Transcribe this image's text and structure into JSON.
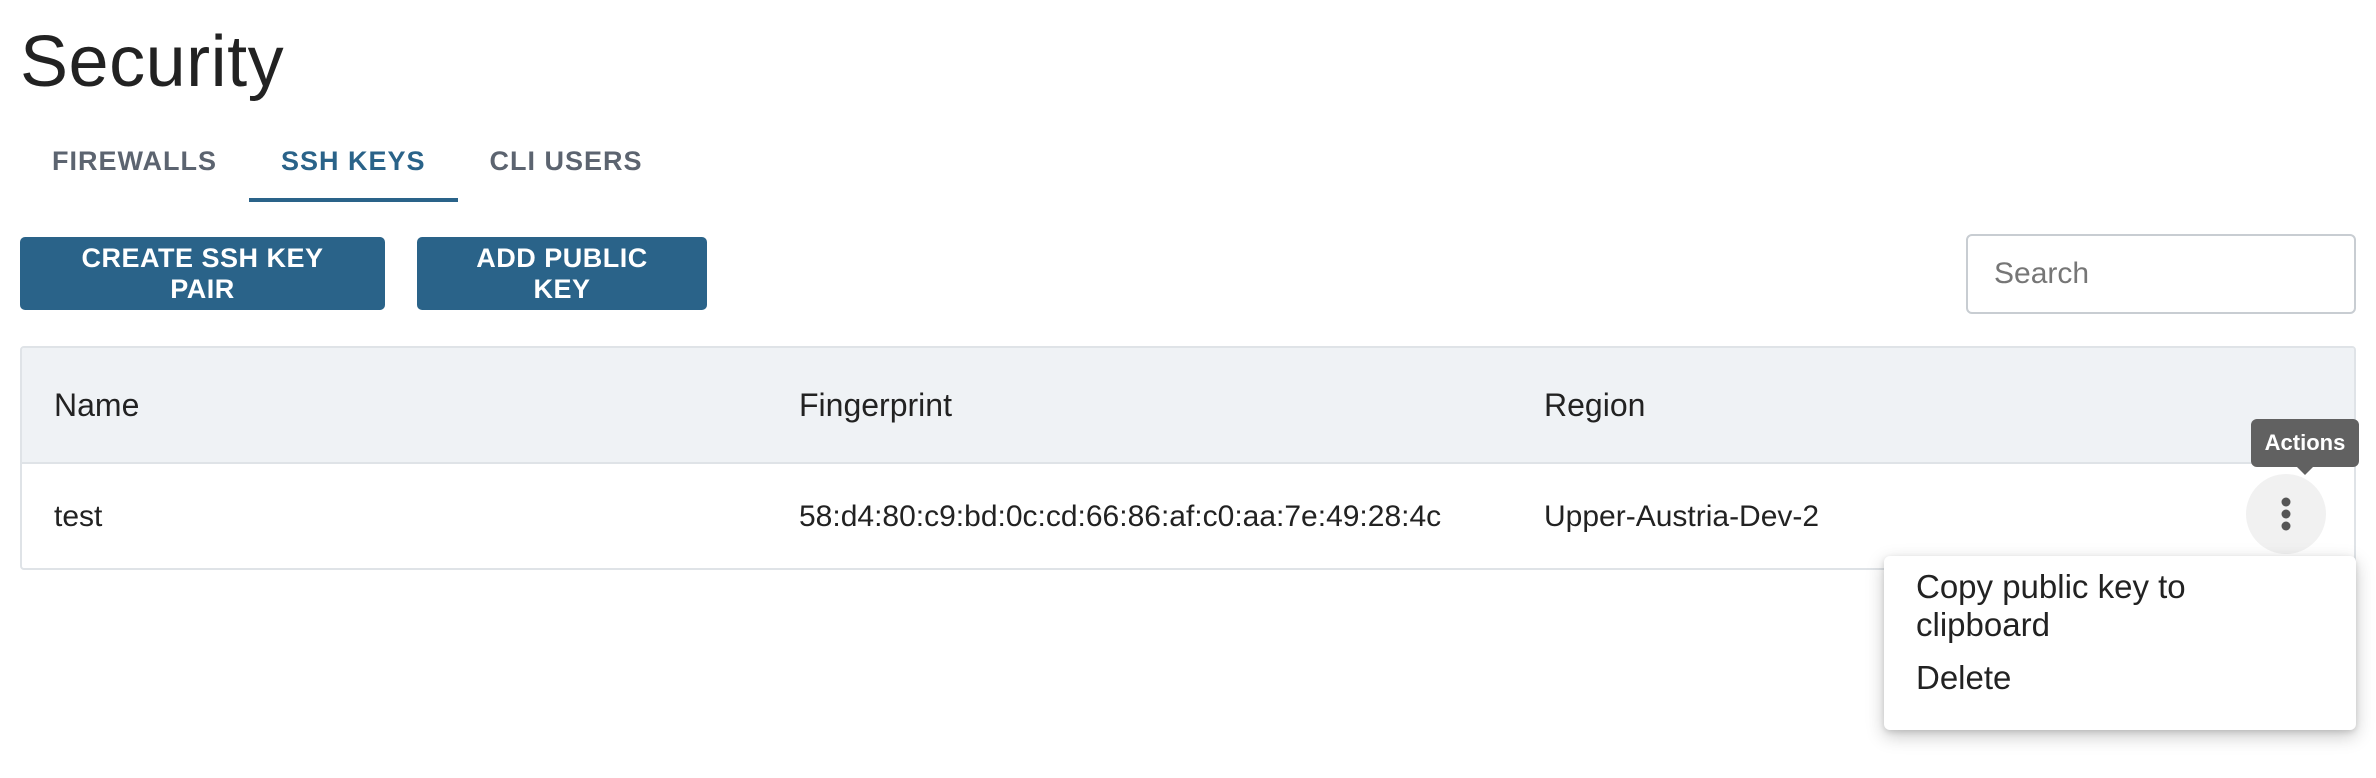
{
  "page": {
    "title": "Security"
  },
  "tabs": [
    {
      "label": "FIREWALLS",
      "active": false
    },
    {
      "label": "SSH KEYS",
      "active": true
    },
    {
      "label": "CLI USERS",
      "active": false
    }
  ],
  "toolbar": {
    "create_label": "CREATE SSH KEY PAIR",
    "add_label": "ADD PUBLIC KEY",
    "search_placeholder": "Search",
    "search_value": ""
  },
  "table": {
    "columns": [
      "Name",
      "Fingerprint",
      "Region"
    ],
    "rows": [
      {
        "name": "test",
        "fingerprint": "58:d4:80:c9:bd:0c:cd:66:86:af:c0:aa:7e:49:28:4c",
        "region": "Upper-Austria-Dev-2"
      }
    ]
  },
  "actions": {
    "tooltip": "Actions",
    "icon": "more-vertical-icon",
    "menu": [
      "Copy public key to clipboard",
      "Delete"
    ]
  },
  "colors": {
    "accent": "#2a6389",
    "header_bg": "#eff2f5",
    "tooltip_bg": "#616161"
  }
}
